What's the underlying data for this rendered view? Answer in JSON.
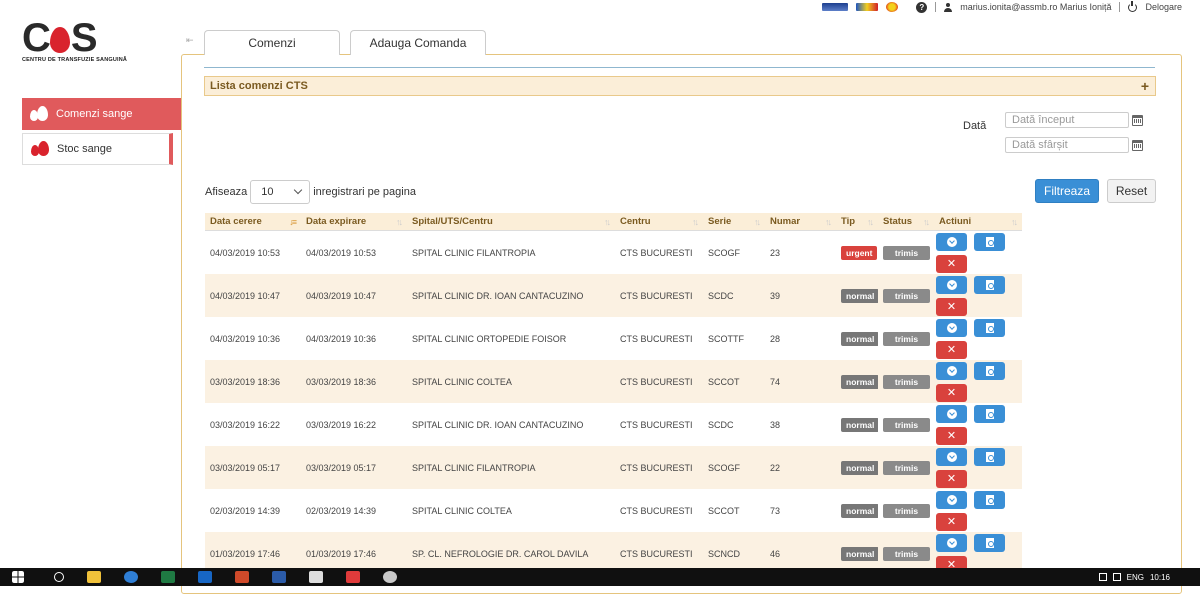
{
  "topbar": {
    "user": "marius.ionita@assmb.ro Marius Ioniță",
    "logout": "Delogare"
  },
  "logo": {
    "subtitle": "CENTRU DE TRANSFUZIE SANGUINĂ"
  },
  "sidebar": {
    "items": [
      {
        "label": "Comenzi sange",
        "active": true
      },
      {
        "label": "Stoc sange",
        "active": false
      }
    ]
  },
  "tabs": [
    {
      "label": "Comenzi"
    },
    {
      "label": "Adauga Comanda"
    }
  ],
  "panel": {
    "title": "Lista comenzi CTS"
  },
  "filters": {
    "date_label": "Dată",
    "start_placeholder": "Dată început",
    "end_placeholder": "Dată sfârșit",
    "filter_button": "Filtreaza",
    "reset_button": "Reset"
  },
  "pagesize": {
    "prefix": "Afiseaza",
    "value": "10",
    "suffix": "inregistrari pe pagina"
  },
  "table": {
    "columns": [
      "Data cerere",
      "Data expirare",
      "Spital/UTS/Centru",
      "Centru",
      "Serie",
      "Numar",
      "Tip",
      "Status",
      "Actiuni"
    ],
    "rows": [
      {
        "data_cerere": "04/03/2019 10:53",
        "data_expirare": "04/03/2019 10:53",
        "spital": "SPITAL CLINIC FILANTROPIA",
        "centru": "CTS BUCURESTI",
        "serie": "SCOGF",
        "numar": "23",
        "tip": "urgent",
        "status": "trimis"
      },
      {
        "data_cerere": "04/03/2019 10:47",
        "data_expirare": "04/03/2019 10:47",
        "spital": "SPITAL CLINIC DR. IOAN CANTACUZINO",
        "centru": "CTS BUCURESTI",
        "serie": "SCDC",
        "numar": "39",
        "tip": "normal",
        "status": "trimis"
      },
      {
        "data_cerere": "04/03/2019 10:36",
        "data_expirare": "04/03/2019 10:36",
        "spital": "SPITAL CLINIC ORTOPEDIE FOISOR",
        "centru": "CTS BUCURESTI",
        "serie": "SCOTTF",
        "numar": "28",
        "tip": "normal",
        "status": "trimis"
      },
      {
        "data_cerere": "03/03/2019 18:36",
        "data_expirare": "03/03/2019 18:36",
        "spital": "SPITAL CLINIC COLTEA",
        "centru": "CTS BUCURESTI",
        "serie": "SCCOT",
        "numar": "74",
        "tip": "normal",
        "status": "trimis"
      },
      {
        "data_cerere": "03/03/2019 16:22",
        "data_expirare": "03/03/2019 16:22",
        "spital": "SPITAL CLINIC DR. IOAN CANTACUZINO",
        "centru": "CTS BUCURESTI",
        "serie": "SCDC",
        "numar": "38",
        "tip": "normal",
        "status": "trimis"
      },
      {
        "data_cerere": "03/03/2019 05:17",
        "data_expirare": "03/03/2019 05:17",
        "spital": "SPITAL CLINIC FILANTROPIA",
        "centru": "CTS BUCURESTI",
        "serie": "SCOGF",
        "numar": "22",
        "tip": "normal",
        "status": "trimis"
      },
      {
        "data_cerere": "02/03/2019 14:39",
        "data_expirare": "02/03/2019 14:39",
        "spital": "SPITAL CLINIC COLTEA",
        "centru": "CTS BUCURESTI",
        "serie": "SCCOT",
        "numar": "73",
        "tip": "normal",
        "status": "trimis"
      },
      {
        "data_cerere": "01/03/2019 17:46",
        "data_expirare": "01/03/2019 17:46",
        "spital": "SP. CL. NEFROLOGIE DR. CAROL DAVILA",
        "centru": "CTS BUCURESTI",
        "serie": "SCNCD",
        "numar": "46",
        "tip": "normal",
        "status": "trimis"
      }
    ]
  },
  "taskbar": {
    "lang": "ENG",
    "time": "10:16"
  },
  "colors": {
    "accent_red": "#e05a5c",
    "primary_blue": "#3a8fd6",
    "header_bg": "#fbeed8",
    "urgent": "#d9423d",
    "normal": "#777777"
  }
}
